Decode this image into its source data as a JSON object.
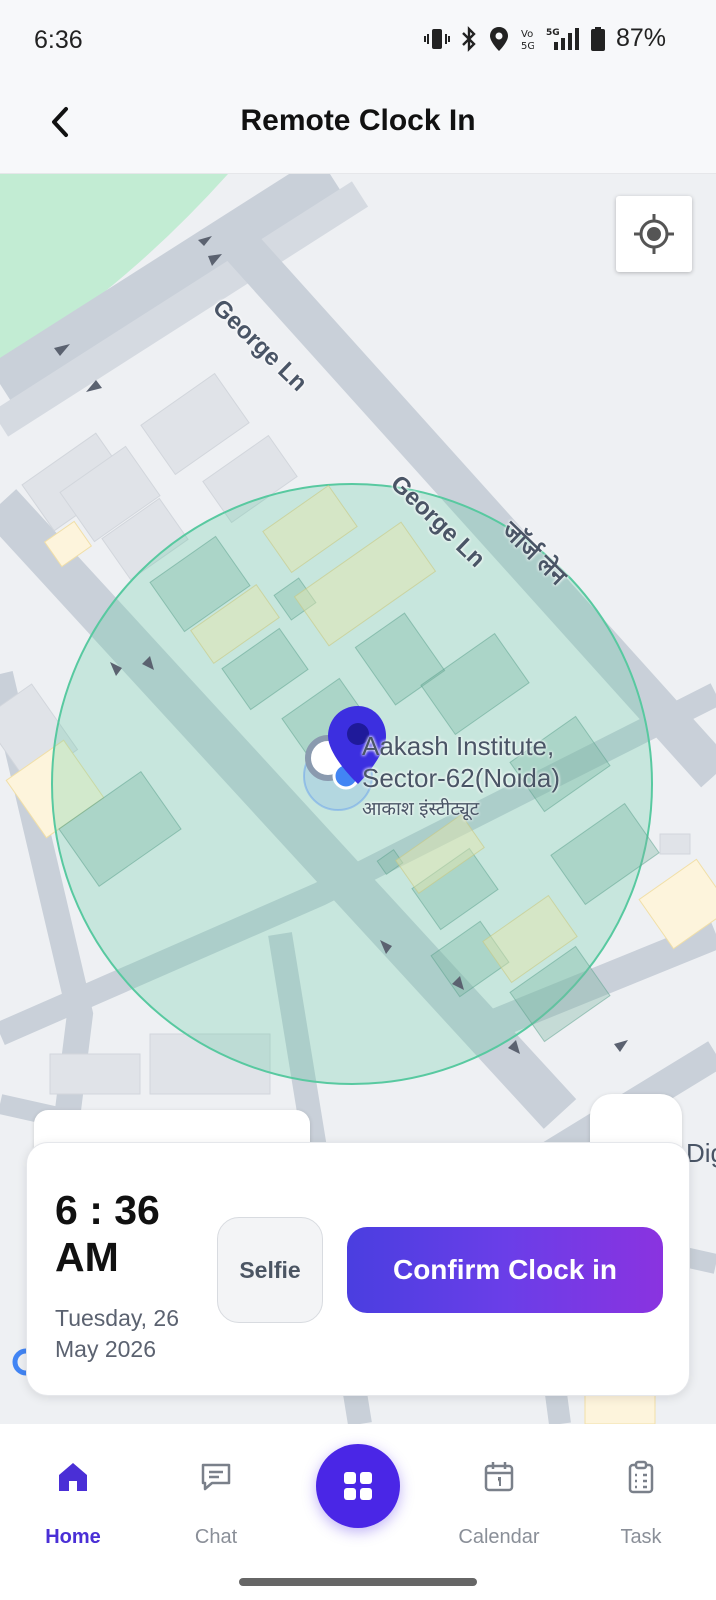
{
  "status_bar": {
    "time": "6:36",
    "battery": "87%",
    "icons": [
      "vibrate-icon",
      "bluetooth-icon",
      "location-icon",
      "volte-icon",
      "5g-signal-icon",
      "battery-icon"
    ]
  },
  "header": {
    "title": "Remote Clock In",
    "back_icon": "chevron-left-icon"
  },
  "map": {
    "road_labels": [
      "George Ln",
      "George Ln",
      "जॉर्ज लेन"
    ],
    "poi": {
      "line1": "Aakash Institute,",
      "line2": "Sector-62(Noida)",
      "line3": "आकाश इंस्टीट्यूट"
    },
    "edge_label": "Dig",
    "geofence_color": "#58c9a0",
    "marker_color": "#3c2fe0",
    "user_dot_color": "#4285f4"
  },
  "clock_card": {
    "time": "6 : 36 AM",
    "date": "Tuesday, 26 May 2026",
    "selfie_label": "Selfie",
    "confirm_label": "Confirm Clock in",
    "accent_gradient": [
      "#4a3ee0",
      "#8a33e0"
    ]
  },
  "bottom_nav": {
    "items": [
      {
        "label": "Home",
        "icon": "home-icon",
        "active": true
      },
      {
        "label": "Chat",
        "icon": "chat-icon",
        "active": false
      },
      {
        "label": "Calendar",
        "icon": "calendar-icon",
        "active": false
      },
      {
        "label": "Task",
        "icon": "clipboard-icon",
        "active": false
      }
    ],
    "center_icon": "grid-icon",
    "active_color": "#4a2fd6"
  }
}
